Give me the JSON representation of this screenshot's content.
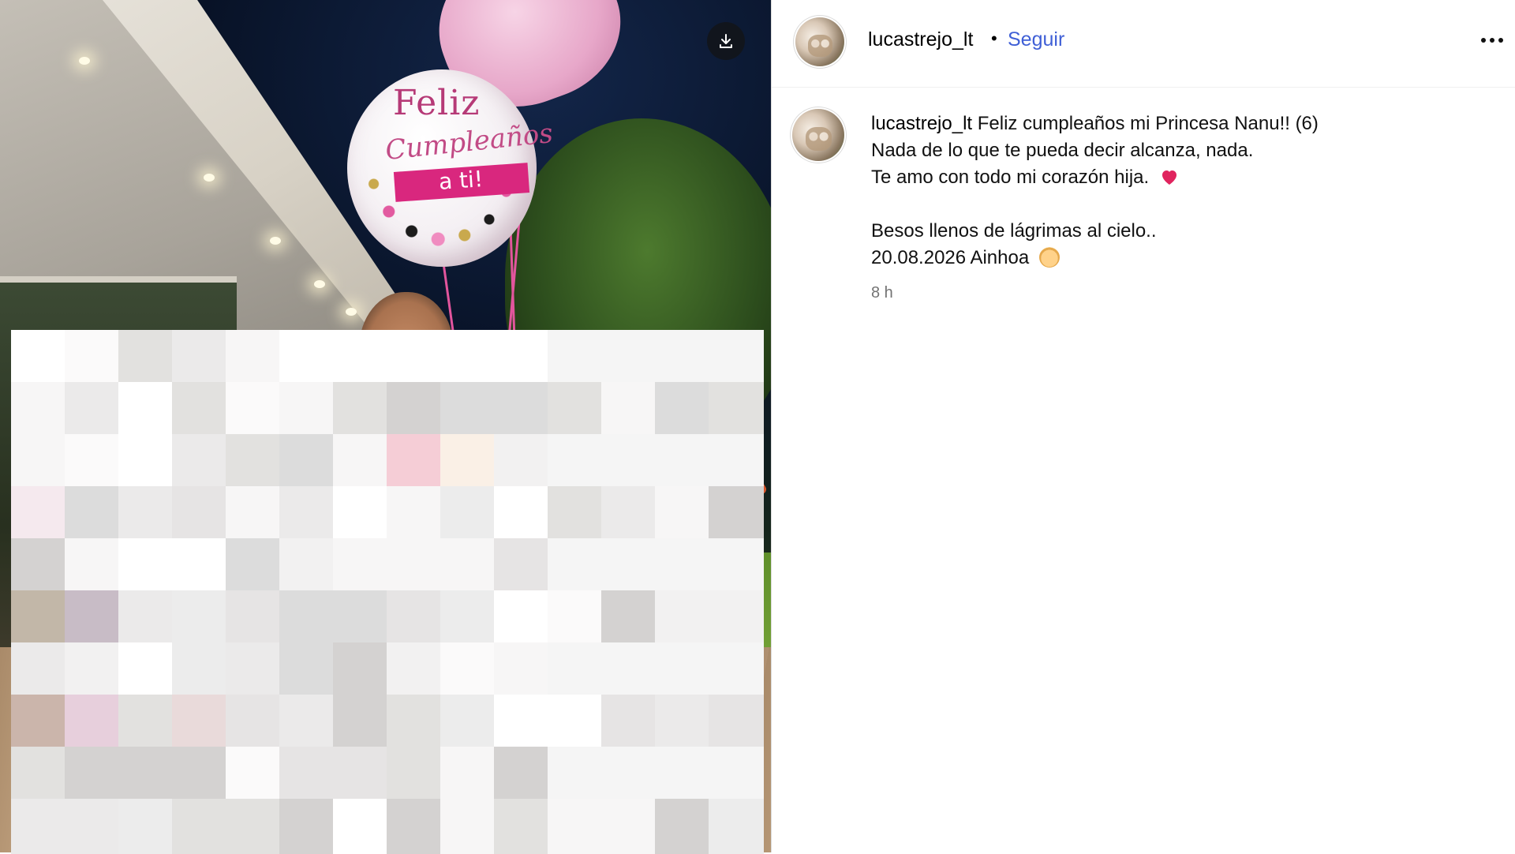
{
  "post": {
    "username": "lucastrejo_lt",
    "separator": "•",
    "follow_label": "Seguir",
    "more_label": "•••",
    "caption": {
      "username": "lucastrejo_lt",
      "line1": "Feliz cumpleaños mi Princesa Nanu!! (6)",
      "line2": "Nada de lo que te pueda decir alcanza, nada.",
      "line3": "Te amo con todo mi corazón hija.",
      "line4": "Besos llenos de lágrimas al cielo..",
      "line5": "20.08.2026 Ainhoa"
    },
    "time_ago": "8 h"
  },
  "photo": {
    "balloon_text_top": "Feliz",
    "balloon_text_mid": "Cumpleaños",
    "balloon_text_banner": "a ti!"
  },
  "icons": {
    "download": "download-icon",
    "prev": "chevron-left-icon",
    "next": "chevron-right-icon",
    "more": "more-horizontal-icon",
    "heart": "red-heart-emoji",
    "angel": "baby-angel-emoji"
  },
  "colors": {
    "follow_blue": "#3f5fd6",
    "secondary_text": "#737373",
    "heart_red": "#e0245e",
    "balloon_pink": "#d9277e"
  }
}
